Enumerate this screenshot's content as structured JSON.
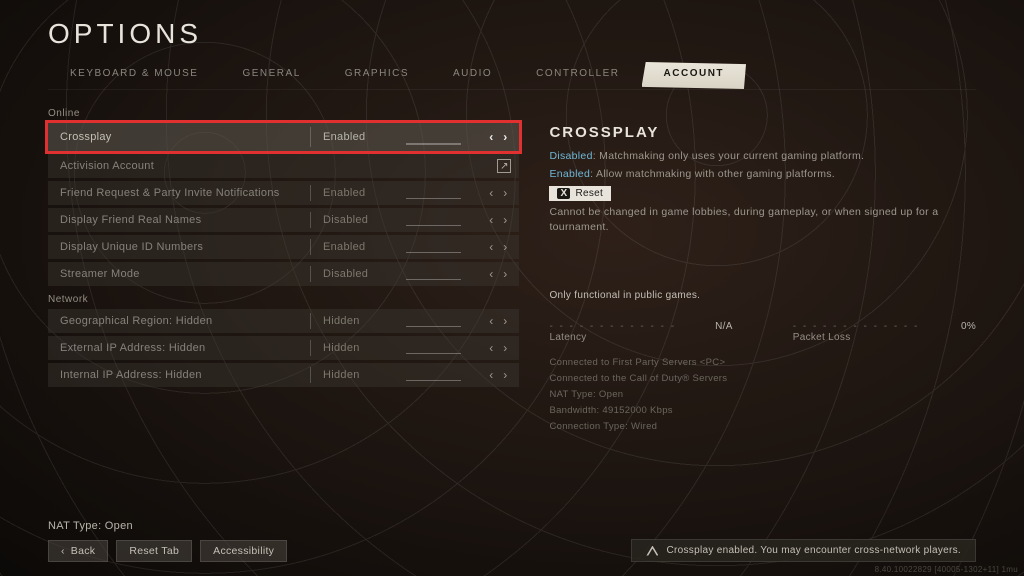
{
  "title": "OPTIONS",
  "tabs": [
    "KEYBOARD & MOUSE",
    "GENERAL",
    "GRAPHICS",
    "AUDIO",
    "CONTROLLER",
    "ACCOUNT"
  ],
  "active_tab": "ACCOUNT",
  "sections": {
    "online_label": "Online",
    "network_label": "Network"
  },
  "rows": {
    "crossplay": {
      "label": "Crossplay",
      "value": "Enabled"
    },
    "activision": {
      "label": "Activision Account"
    },
    "friend_req": {
      "label": "Friend Request & Party Invite Notifications",
      "value": "Enabled"
    },
    "real_names": {
      "label": "Display Friend Real Names",
      "value": "Disabled"
    },
    "unique_id": {
      "label": "Display Unique ID Numbers",
      "value": "Enabled"
    },
    "streamer": {
      "label": "Streamer Mode",
      "value": "Disabled"
    },
    "geo": {
      "label": "Geographical Region: Hidden",
      "value": "Hidden"
    },
    "ext_ip": {
      "label": "External IP Address: Hidden",
      "value": "Hidden"
    },
    "int_ip": {
      "label": "Internal IP Address: Hidden",
      "value": "Hidden"
    }
  },
  "detail": {
    "title": "CROSSPLAY",
    "disabled_key": "Disabled",
    "disabled_text": ": Matchmaking only uses your current gaming platform.",
    "enabled_key": "Enabled",
    "enabled_text": ": Allow matchmaking with other gaming platforms.",
    "reset_key": "X",
    "reset_label": "Reset",
    "restriction": "Cannot be changed in game lobbies, during gameplay, or when signed up for a tournament.",
    "note": "Only functional in public games.",
    "latency_label": "Latency",
    "latency_value": "N/A",
    "packet_label": "Packet Loss",
    "packet_value": "0%",
    "conn1": "Connected to First Party Servers  <PC>",
    "conn2": "Connected to the Call of Duty® Servers",
    "conn3": "NAT Type: Open",
    "conn4": "Bandwidth: 49152000 Kbps",
    "conn5": "Connection Type: Wired"
  },
  "bottom": {
    "nat": "NAT Type: Open",
    "back": "Back",
    "reset_tab": "Reset Tab",
    "accessibility": "Accessibility",
    "toast": "Crossplay enabled. You may encounter cross-network players.",
    "build": "8.40.10022829 [40005-1302+11] 1mu"
  }
}
